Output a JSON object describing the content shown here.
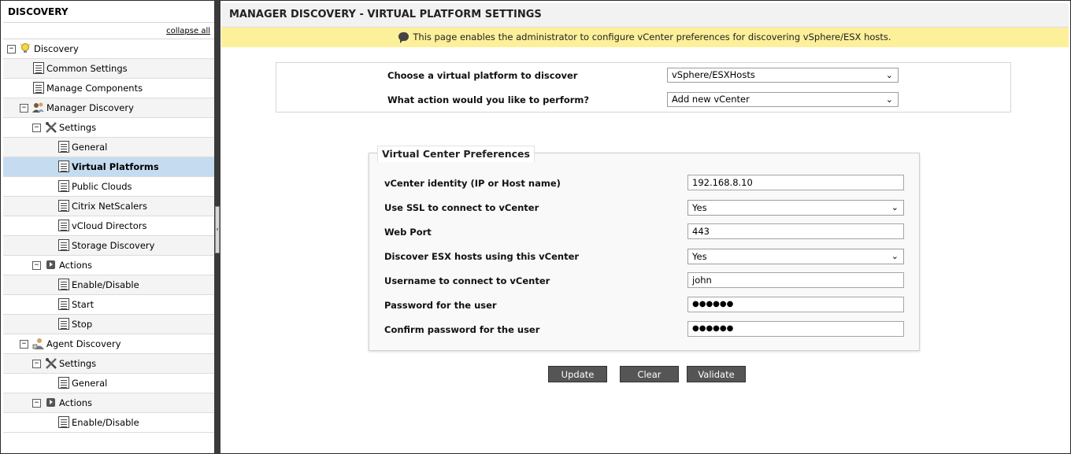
{
  "sidebar": {
    "title": "DISCOVERY",
    "collapse_all": "collapse all",
    "items": [
      {
        "label": "Discovery",
        "toggle": "−"
      },
      {
        "label": "Common Settings"
      },
      {
        "label": "Manage Components"
      },
      {
        "label": "Manager Discovery",
        "toggle": "−"
      },
      {
        "label": "Settings",
        "toggle": "−"
      },
      {
        "label": "General"
      },
      {
        "label": "Virtual Platforms"
      },
      {
        "label": "Public Clouds"
      },
      {
        "label": "Citrix NetScalers"
      },
      {
        "label": "vCloud Directors"
      },
      {
        "label": "Storage Discovery"
      },
      {
        "label": "Actions",
        "toggle": "−"
      },
      {
        "label": "Enable/Disable"
      },
      {
        "label": "Start"
      },
      {
        "label": "Stop"
      },
      {
        "label": "Agent Discovery",
        "toggle": "−"
      },
      {
        "label": "Settings",
        "toggle": "−"
      },
      {
        "label": "General"
      },
      {
        "label": "Actions",
        "toggle": "−"
      },
      {
        "label": "Enable/Disable"
      }
    ],
    "selected": "Virtual Platforms",
    "splitter_glyph": "‹"
  },
  "page": {
    "title": "MANAGER DISCOVERY - VIRTUAL PLATFORM SETTINGS",
    "banner": "This page enables the administrator to configure vCenter preferences for discovering vSphere/ESX hosts."
  },
  "platform": {
    "choose_label": "Choose a virtual platform to discover",
    "choose_value": "vSphere/ESXHosts",
    "action_label": "What action would you like to perform?",
    "action_value": "Add new vCenter",
    "chevron": "⌄"
  },
  "vcenter": {
    "legend": "Virtual Center Preferences",
    "identity_label": "vCenter identity (IP or Host name)",
    "identity_value": "192.168.8.10",
    "ssl_label": "Use SSL to connect to vCenter",
    "ssl_value": "Yes",
    "port_label": "Web Port",
    "port_value": "443",
    "discover_label": "Discover ESX hosts using this vCenter",
    "discover_value": "Yes",
    "username_label": "Username to connect to vCenter",
    "username_value": "john",
    "password_label": "Password for the user",
    "password_value": "●●●●●●",
    "confirm_label": "Confirm password for the user",
    "confirm_value": "●●●●●●"
  },
  "buttons": {
    "update": "Update",
    "clear": "Clear",
    "validate": "Validate"
  },
  "colors": {
    "banner": "#fdf09a",
    "selected_row": "#c5dcf0",
    "button": "#555555"
  }
}
